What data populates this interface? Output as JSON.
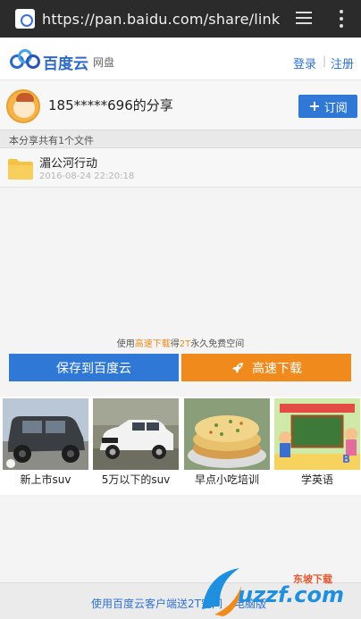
{
  "browser": {
    "url": "https://pan.baidu.com/share/link?uk="
  },
  "header": {
    "logo_title": "百度云",
    "logo_sub": "网盘",
    "login_label": "登录",
    "separator": "|",
    "register_label": "注册"
  },
  "share": {
    "owner_title": "185*****696的分享",
    "subscribe_label": "订阅",
    "subscribe_icon": "plus-icon",
    "count_text": "本分享共有1个文件",
    "files": [
      {
        "name": "湄公河行动",
        "date": "2016-08-24 22:20:18",
        "icon": "folder-icon"
      }
    ]
  },
  "promo": {
    "prefix": "使用",
    "highlight1": "高速下载",
    "middle": "得",
    "highlight2": "2T",
    "suffix": "永久免费空间",
    "save_label": "保存到百度云",
    "download_label": "高速下载",
    "download_icon": "rocket-icon"
  },
  "ads": [
    {
      "label": "新上市suv"
    },
    {
      "label": "5万以下的suv"
    },
    {
      "label": "早点小吃培训"
    },
    {
      "label": "学英语"
    }
  ],
  "footer": {
    "text": "使用百度云客户端送2T空间",
    "pc_label": "电脑版"
  },
  "watermark": {
    "brand": "uzzf.com",
    "tagline": "东坡下载"
  },
  "colors": {
    "accent_blue": "#2f78d6",
    "accent_orange": "#f08a1c",
    "browser_bar": "#2b2b2b"
  }
}
